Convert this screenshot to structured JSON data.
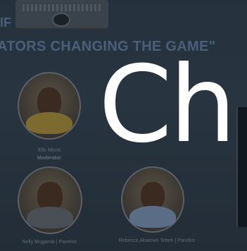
{
  "slide": {
    "headline_partial_top": "IF",
    "headline": "ATORS CHANGING THE GAME\"",
    "speakers": [
      {
        "name": "Efik Nfonti",
        "role": "Moderator"
      },
      {
        "name": "Nelly Mugambi | Panelist",
        "role": ""
      },
      {
        "name": "Rebecca Akweiwo Tetteh | Panelist",
        "role": ""
      }
    ]
  },
  "overlay": {
    "text": "Ch"
  }
}
